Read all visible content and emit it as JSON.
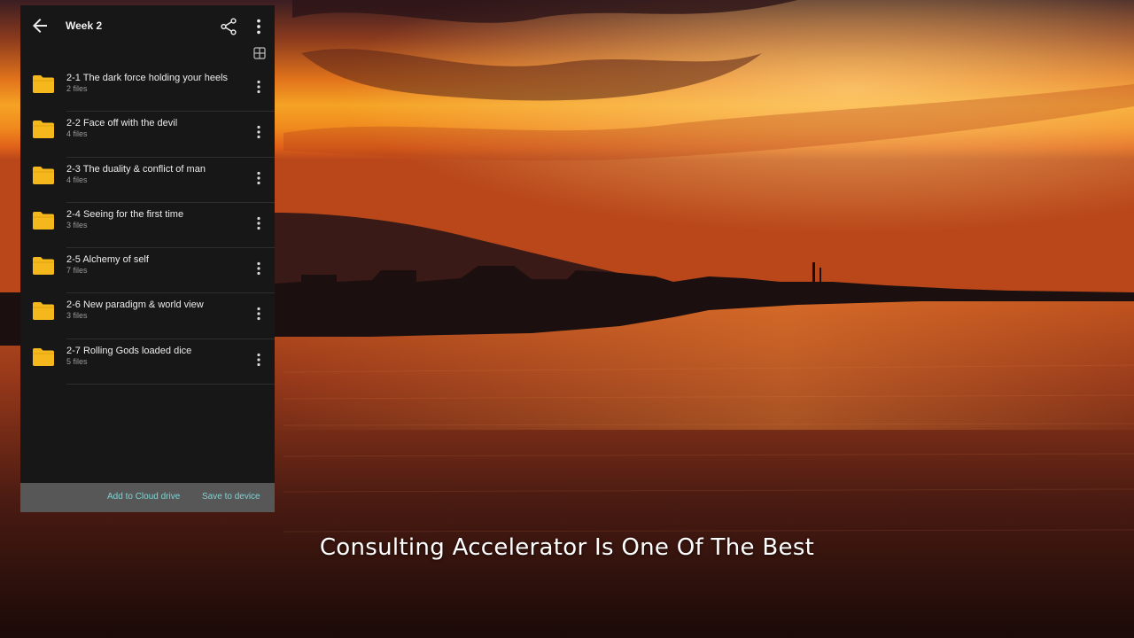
{
  "header": {
    "title": "Week 2"
  },
  "icons": {
    "back": "arrow-left-icon",
    "share": "share-icon",
    "more": "more-vert-icon",
    "grid": "grid-view-icon",
    "folder": "folder-icon"
  },
  "folders": [
    {
      "name": "2-1 The dark force holding your heels",
      "count": "2 files"
    },
    {
      "name": "2-2 Face off with the devil",
      "count": "4 files"
    },
    {
      "name": "2-3 The duality & conflict of man",
      "count": "4 files"
    },
    {
      "name": "2-4 Seeing for the first time",
      "count": "3 files"
    },
    {
      "name": "2-5 Alchemy of self",
      "count": "7 files"
    },
    {
      "name": "2-6 New paradigm & world view",
      "count": "3 files"
    },
    {
      "name": "2-7 Rolling Gods loaded dice",
      "count": "5 files"
    }
  ],
  "bottom_bar": {
    "add_cloud": "Add to Cloud drive",
    "save_device": "Save to device"
  },
  "subtitle": "Consulting Accelerator Is One Of The Best",
  "colors": {
    "folder": "#f5b81c",
    "accent": "#7fd3d3",
    "panel_bg": "#171717",
    "bottom_bar_bg": "#575757"
  }
}
